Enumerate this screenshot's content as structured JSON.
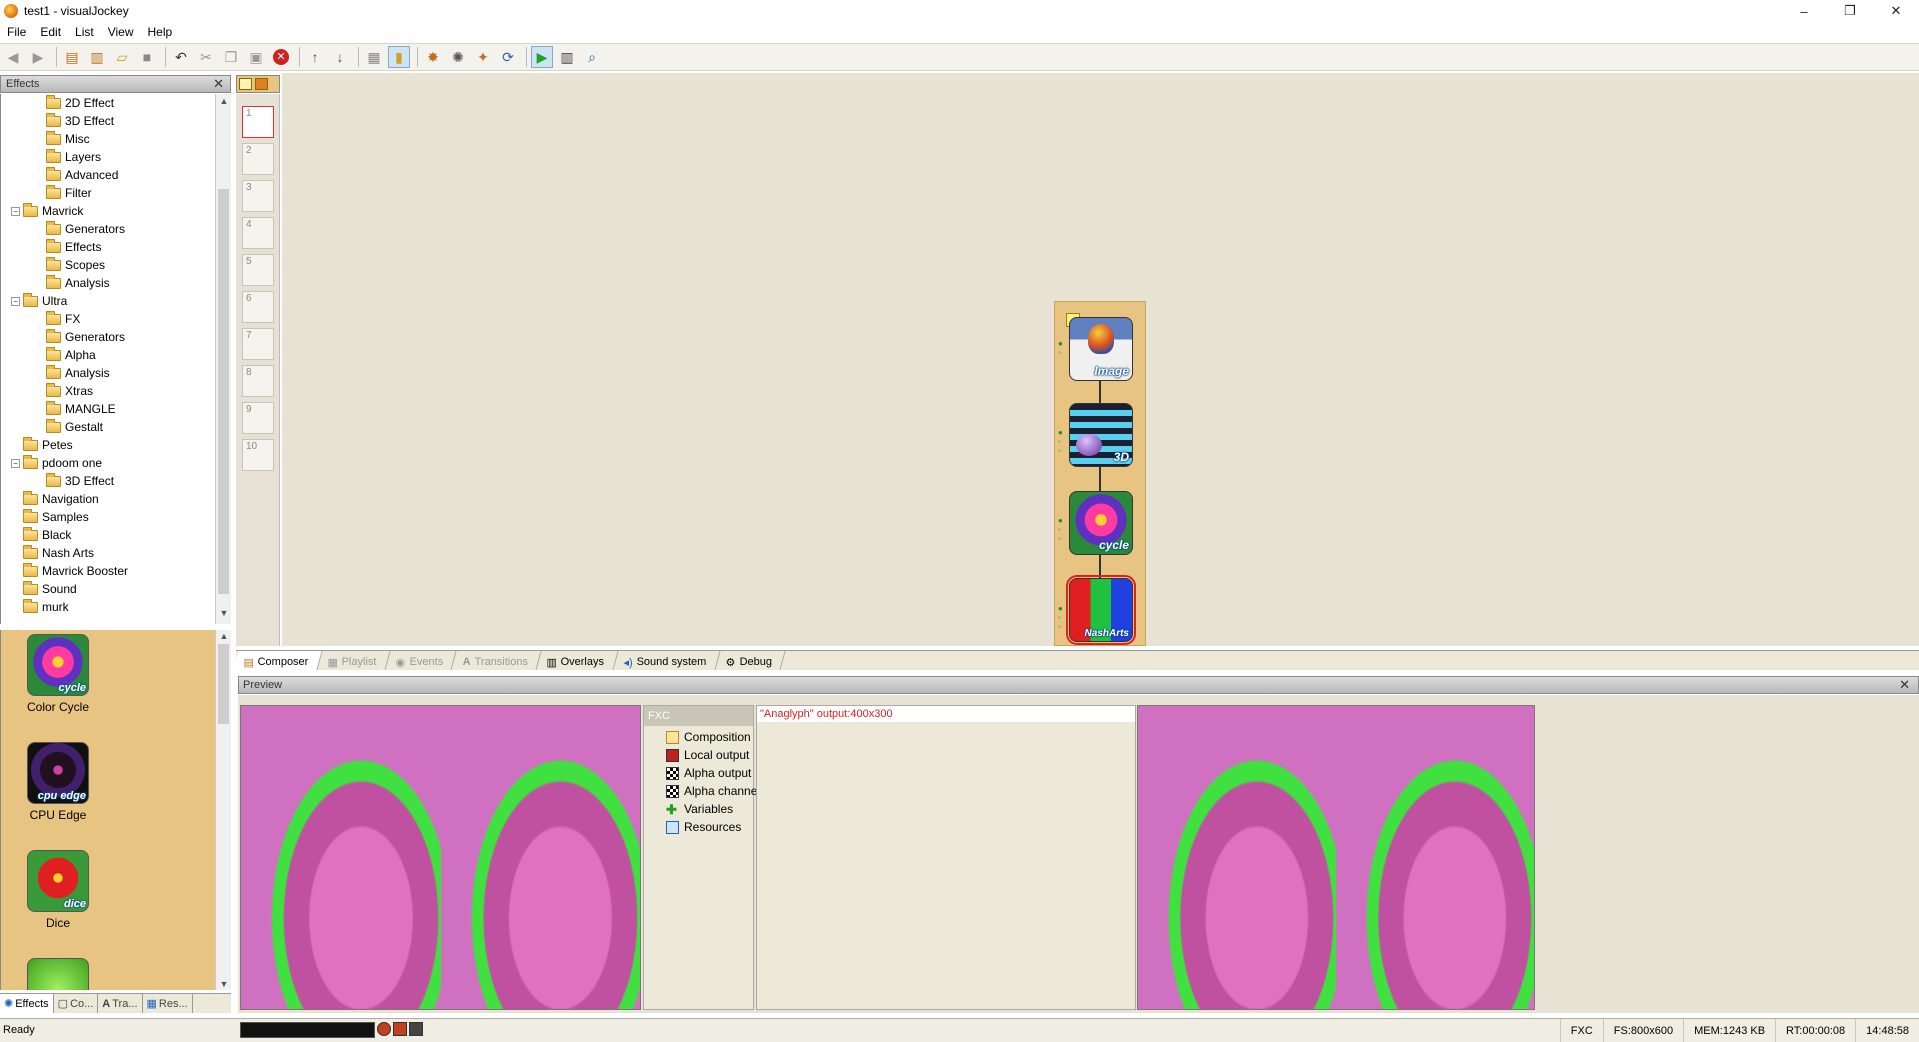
{
  "window": {
    "title": "test1 - visualJockey",
    "minimize": "–",
    "maximize": "❐",
    "close": "✕"
  },
  "menu": {
    "items": [
      "File",
      "Edit",
      "List",
      "View",
      "Help"
    ]
  },
  "effects_panel": {
    "title": "Effects",
    "tree": [
      {
        "label": "2D Effect",
        "level": 1
      },
      {
        "label": "3D Effect",
        "level": 1
      },
      {
        "label": "Misc",
        "level": 1
      },
      {
        "label": "Layers",
        "level": 1
      },
      {
        "label": "Advanced",
        "level": 1
      },
      {
        "label": "Filter",
        "level": 1
      },
      {
        "label": "Mavrick",
        "level": 0,
        "expanded": true
      },
      {
        "label": "Generators",
        "level": 1
      },
      {
        "label": "Effects",
        "level": 1
      },
      {
        "label": "Scopes",
        "level": 1
      },
      {
        "label": "Analysis",
        "level": 1
      },
      {
        "label": "Ultra",
        "level": 0,
        "expanded": true
      },
      {
        "label": "FX",
        "level": 1
      },
      {
        "label": "Generators",
        "level": 1
      },
      {
        "label": "Alpha",
        "level": 1
      },
      {
        "label": "Analysis",
        "level": 1
      },
      {
        "label": "Xtras",
        "level": 1
      },
      {
        "label": "MANGLE",
        "level": 1
      },
      {
        "label": "Gestalt",
        "level": 1
      },
      {
        "label": "Petes",
        "level": 0
      },
      {
        "label": "pdoom one",
        "level": 0,
        "expanded": true
      },
      {
        "label": "3D Effect",
        "level": 1
      },
      {
        "label": "Navigation",
        "level": 0
      },
      {
        "label": "Samples",
        "level": 0
      },
      {
        "label": "Black",
        "level": 0
      },
      {
        "label": "Nash Arts",
        "level": 0
      },
      {
        "label": "Mavrick Booster",
        "level": 0
      },
      {
        "label": "Sound",
        "level": 0
      },
      {
        "label": "murk",
        "level": 0
      }
    ],
    "thumbnails": [
      {
        "label": "Color Cycle",
        "tag": "cycle"
      },
      {
        "label": "CPU Edge",
        "tag": "cpu edge"
      },
      {
        "label": "Dice",
        "tag": "dice"
      }
    ],
    "tabs": [
      "Effects",
      "Co...",
      "Tra...",
      "Res..."
    ]
  },
  "strip": {
    "slots": [
      "1",
      "2",
      "3",
      "4",
      "5",
      "6",
      "7",
      "8",
      "9",
      "10"
    ]
  },
  "composer": {
    "nodes": [
      {
        "name": "image-node",
        "tag": "Image"
      },
      {
        "name": "3d-node",
        "tag": "3D"
      },
      {
        "name": "cycle-node",
        "tag": "cycle"
      },
      {
        "name": "nasharts-node",
        "tag": "NashArts"
      }
    ]
  },
  "center_tabs": [
    {
      "label": "Composer",
      "state": "active"
    },
    {
      "label": "Playlist",
      "state": "disabled"
    },
    {
      "label": "Events",
      "state": "disabled"
    },
    {
      "label": "Transitions",
      "state": "disabled"
    },
    {
      "label": "Overlays",
      "state": "enabled"
    },
    {
      "label": "Sound system",
      "state": "enabled"
    },
    {
      "label": "Debug",
      "state": "enabled"
    }
  ],
  "preview": {
    "title": "Preview",
    "fxc_title": "FXC",
    "fxc_items": [
      "Composition",
      "Local output",
      "Alpha output",
      "Alpha channel",
      "Variables",
      "Resources"
    ],
    "output_line": "\"Anaglyph\" output:400x300"
  },
  "status": {
    "ready": "Ready",
    "fxc": "FXC",
    "fs": "FS:800x600",
    "mem": "MEM:1243 KB",
    "rt": "RT:00:00:08",
    "time": "14:48:58"
  }
}
